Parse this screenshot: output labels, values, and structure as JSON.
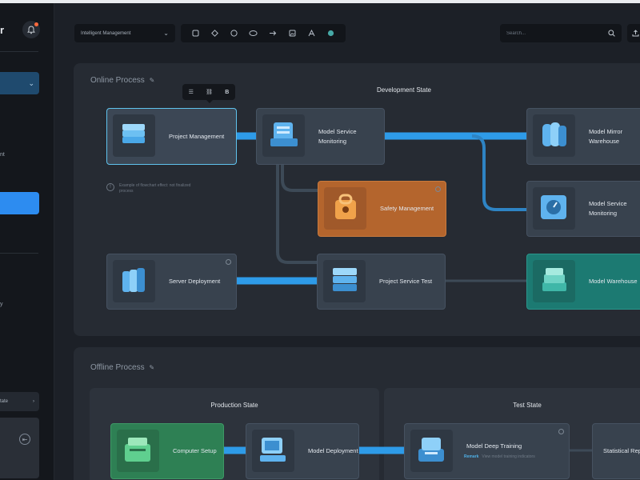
{
  "sidebar": {
    "brand_fragment": "r",
    "frag1": "nt",
    "frag2": "y",
    "bottom_button": "tate"
  },
  "toolbar": {
    "dropdown_value": "Intelligent Management",
    "search_placeholder": "Search..."
  },
  "online": {
    "title": "Online Process",
    "state_label": "Development State",
    "note": "Example of flowchart effect: not finalized process",
    "nodes": {
      "project_management": "Project Management",
      "model_service_monitoring": "Model Service Monitoring",
      "model_mirror_warehouse": "Model Mirror Warehouse",
      "safety_management": "Safety Management",
      "model_service_monitoring_2": "Model Service Monitoring",
      "server_deployment": "Server Deployment",
      "project_service_test": "Project Service Test",
      "model_warehouse": "Model Warehouse"
    }
  },
  "offline": {
    "title": "Offline Process",
    "production_label": "Production State",
    "test_label": "Test State",
    "nodes": {
      "computer_setup": "Computer Setup",
      "model_deployment": "Model Deployment",
      "model_deep_training": "Model Deep Training",
      "statistical_report": "Statistical Report"
    },
    "remark_label": "Remark",
    "remark_text": "View model training indicators"
  },
  "colors": {
    "accent": "#2d8cf0",
    "selected_border": "#5fc3ee",
    "safety": "#b4652d",
    "warehouse": "#1c7a72",
    "computer_setup": "#2e8054"
  }
}
